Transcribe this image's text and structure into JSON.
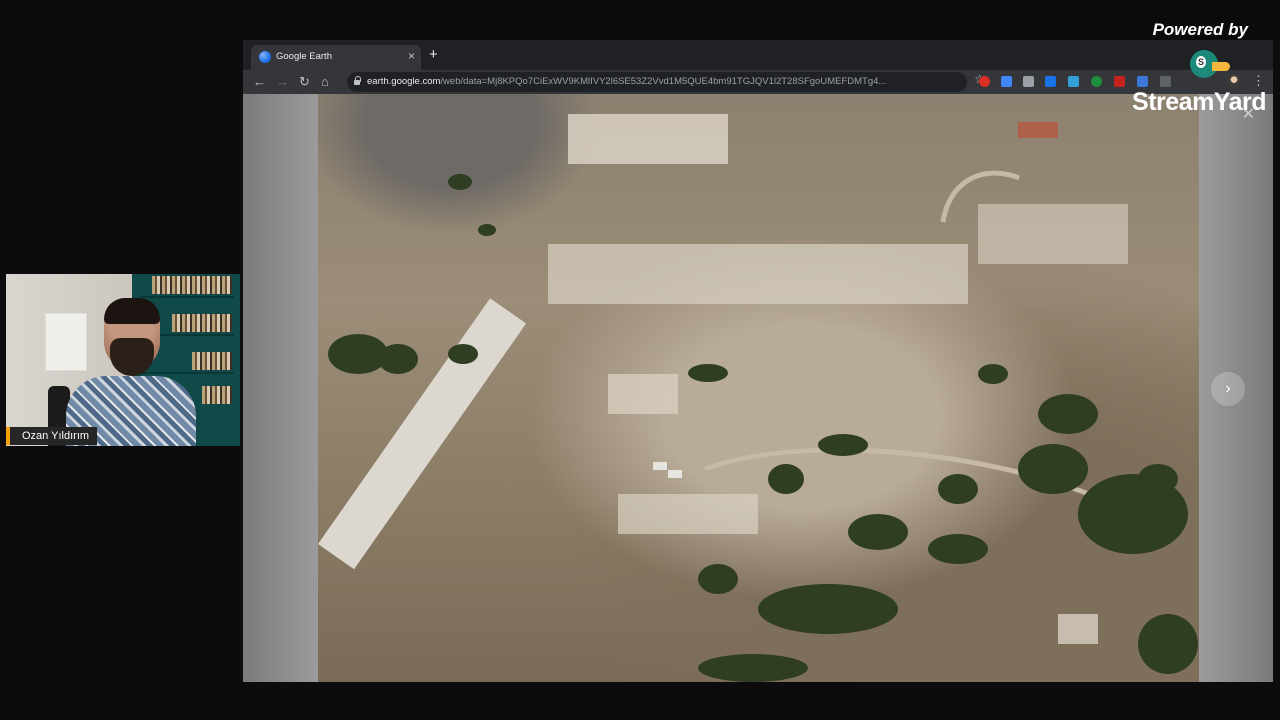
{
  "webcam": {
    "participant_name": "Ozan Yıldırım"
  },
  "browser": {
    "tab_title": "Google Earth",
    "new_tab_symbol": "+",
    "tab_close_symbol": "×",
    "url_host": "earth.google.com",
    "url_path": "/web/data=Mj8KPQo7CiExWV9KMlIVY2l6SE53Z2Vvd1M5QUE4bm91TGJQV1l2T28SFgoUMEFDMTg4..."
  },
  "viewer": {
    "next_label": "›",
    "close_label": "✕"
  },
  "branding": {
    "powered_by": "Powered by",
    "logo_badge": "S",
    "name": "StreamYard"
  },
  "colors": {
    "name_accent": "#f5a200",
    "browser_chrome": "#35363a",
    "tab_bar": "#202124"
  },
  "icons": [
    "back-arrow-icon",
    "forward-arrow-icon",
    "reload-icon",
    "home-icon",
    "lock-icon",
    "star-icon",
    "menu-dots-icon",
    "google-earth-icon"
  ]
}
